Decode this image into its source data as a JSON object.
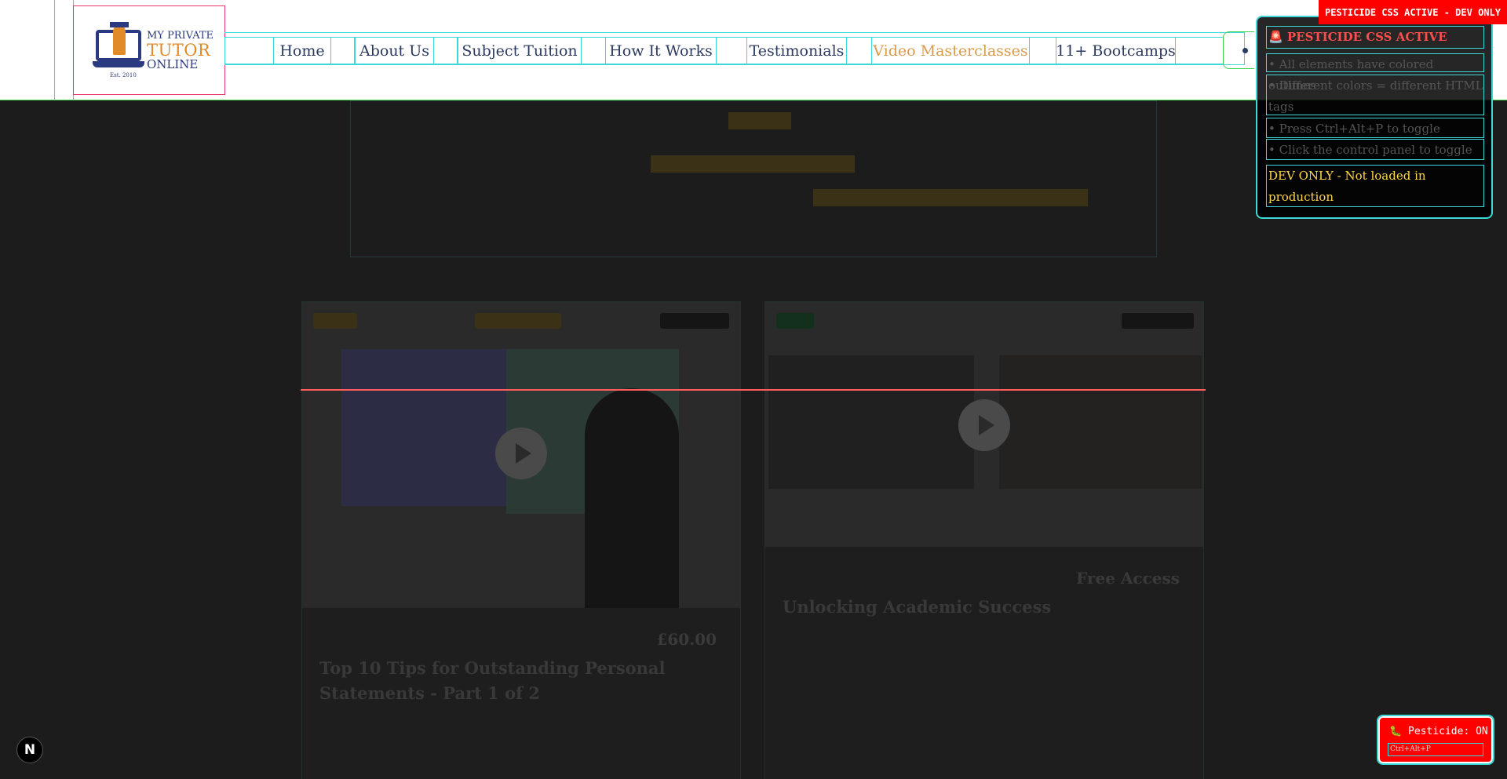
{
  "header": {
    "logo": {
      "line1": "MY PRIVATE",
      "line2": "TUTOR",
      "line3": "ONLINE",
      "est": "Est. 2010"
    },
    "nav": [
      {
        "label": "Home"
      },
      {
        "label": "About Us"
      },
      {
        "label": "Subject Tuition"
      },
      {
        "label": "How It Works"
      },
      {
        "label": "Testimonials"
      },
      {
        "label": "Video Masterclasses",
        "active": true
      },
      {
        "label": "11+ Bootcamps"
      }
    ]
  },
  "pesticide": {
    "banner": "PESTICIDE CSS ACTIVE - DEV ONLY",
    "panel_title": "🚨 PESTICIDE CSS ACTIVE",
    "panel_lines": [
      "• All elements have colored outlines",
      "• Different colors = different HTML tags",
      "• Press Ctrl+Alt+P to toggle",
      "• Click the control panel to toggle"
    ],
    "dev_note": "DEV ONLY - Not loaded in production",
    "toggle_label": "🐛 Pesticide: ON",
    "toggle_shortcut": "Ctrl+Alt+P"
  },
  "background": {
    "cards": [
      {
        "price": "£60.00",
        "title": "Top 10 Tips for Outstanding Personal Statements - Part 1 of 2"
      },
      {
        "price": "Free Access",
        "title": "Unlocking Academic Success"
      }
    ]
  },
  "nextjs_badge": "N",
  "colors": {
    "outline_cyan": "#3fd8d8",
    "outline_pink": "#e8336b",
    "outline_green": "#3bd34a",
    "pesticide_red": "#ff0000",
    "accent_gold": "#d99a4c",
    "brand_navy": "#2b3a80"
  }
}
